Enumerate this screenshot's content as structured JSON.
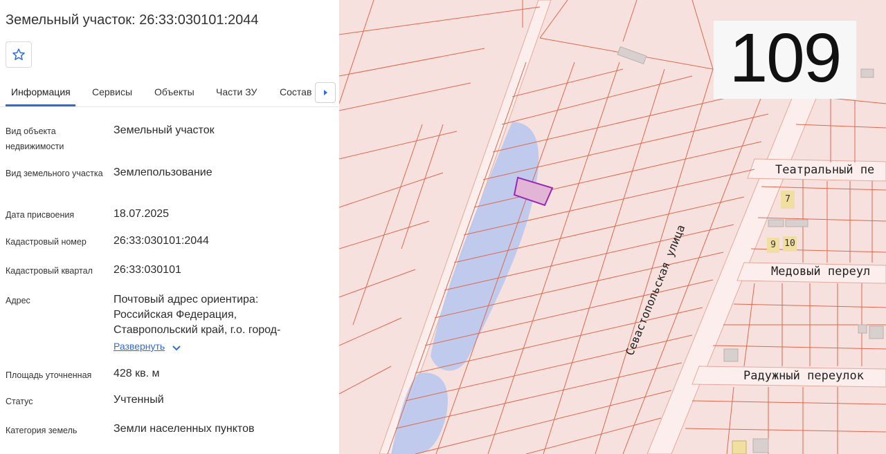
{
  "panel": {
    "title": "Земельный участок: 26:33:030101:2044",
    "tabs": [
      "Информация",
      "Сервисы",
      "Объекты",
      "Части ЗУ",
      "Состав"
    ],
    "rows": [
      {
        "label": "Вид объекта недвижимости",
        "value": "Земельный участок"
      },
      {
        "label": "Вид земельного участка",
        "value": "Землепользование"
      },
      {
        "label": "Дата присвоения",
        "value": "18.07.2025"
      },
      {
        "label": "Кадастровый номер",
        "value": "26:33:030101:2044"
      },
      {
        "label": "Кадастровый квартал",
        "value": "26:33:030101"
      },
      {
        "label": "Адрес",
        "value": "Почтовый адрес ориентира: Российская Федерация, Ставропольский край, г.о. город-"
      },
      {
        "label": "Площадь уточненная",
        "value": "428 кв. м"
      },
      {
        "label": "Статус",
        "value": "Учтенный"
      },
      {
        "label": "Категория земель",
        "value": "Земли населенных пунктов"
      }
    ],
    "expand_label": "Развернуть"
  },
  "map": {
    "badge": "109",
    "streets": {
      "teatralny": "Театральный пе",
      "medovy": "Медовый переул",
      "raduzhny": "Радужный переулок",
      "sevastopolskaya": "Севастопольская улица"
    },
    "house_numbers": [
      "7",
      "9",
      "10"
    ]
  },
  "colors": {
    "accent": "#2e6bd6",
    "parcel_fill": "#f6e1de",
    "parcel_line": "#e0674a",
    "water": "#b9c8ee",
    "selected": "#9c27b0"
  }
}
